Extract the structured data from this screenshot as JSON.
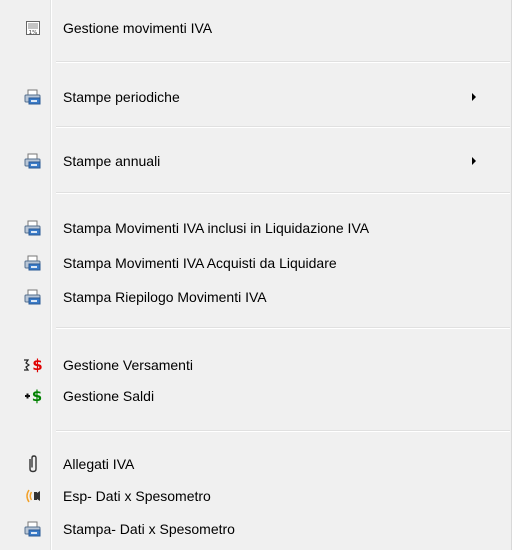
{
  "menu": {
    "items": [
      {
        "label": "Gestione movimenti IVA",
        "icon": "percent-sheet-icon"
      },
      {
        "label": "Stampe periodiche",
        "icon": "printer-icon",
        "submenu": true
      },
      {
        "label": "Stampe annuali",
        "icon": "printer-icon",
        "submenu": true
      },
      {
        "label": "Stampa Movimenti IVA inclusi in Liquidazione IVA",
        "icon": "printer-icon"
      },
      {
        "label": "Stampa Movimenti IVA Acquisti da Liquidare",
        "icon": "printer-icon"
      },
      {
        "label": "Stampa Riepilogo Movimenti IVA",
        "icon": "printer-icon"
      },
      {
        "label": "Gestione Versamenti",
        "icon": "red-dollar-icon",
        "icon_text": "$"
      },
      {
        "label": "Gestione Saldi",
        "icon": "green-dollar-icon",
        "icon_text": "$"
      },
      {
        "label": "Allegati IVA",
        "icon": "paperclip-icon"
      },
      {
        "label": "Esp- Dati x Spesometro",
        "icon": "broadcast-icon"
      },
      {
        "label": "Stampa- Dati x Spesometro",
        "icon": "printer-icon"
      }
    ]
  },
  "colors": {
    "menu_background": "#f0f0f0",
    "red_dollar": "#e00000",
    "green_dollar": "#008000",
    "printer_blue": "#3a7bc8"
  }
}
